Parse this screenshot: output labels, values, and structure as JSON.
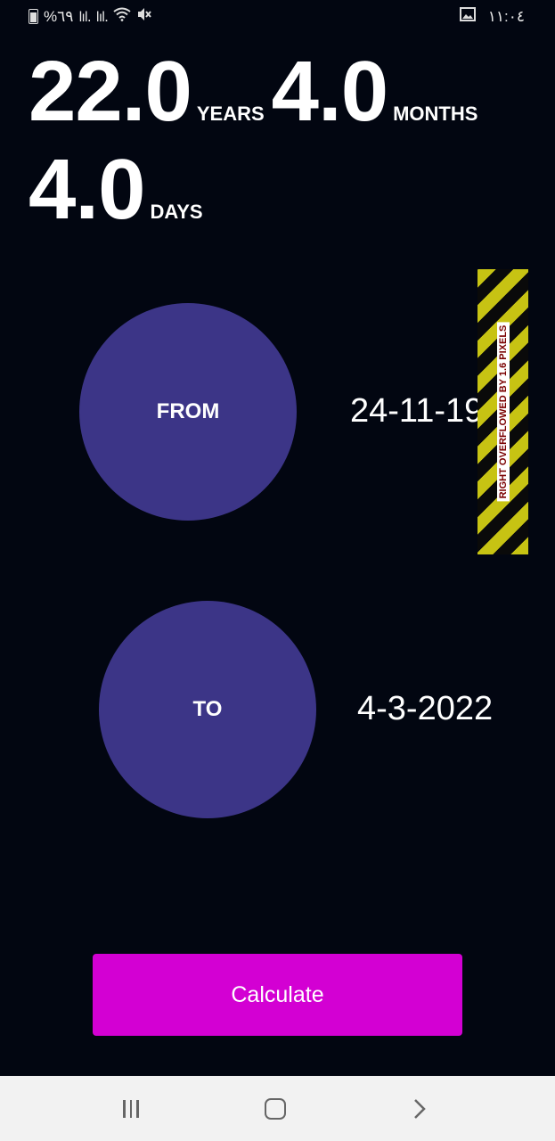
{
  "status_bar": {
    "battery_percent": "%٦٩",
    "signal_1": "lıl.",
    "signal_2": "lıl.",
    "time": "١١:٠٤",
    "icons": [
      "battery-icon",
      "signal-icon",
      "signal-icon",
      "wifi-icon",
      "mute-icon",
      "image-icon"
    ]
  },
  "result": {
    "years_value": "22.0",
    "years_label": "YEARS",
    "months_value": "4.0",
    "months_label": "MONTHS",
    "days_value": "4.0",
    "days_label": "DAYS"
  },
  "from": {
    "label": "FROM",
    "date": "24-11-1999"
  },
  "to": {
    "label": "TO",
    "date": "4-3-2022"
  },
  "overflow_warning": "RIGHT OVERFLOWED BY 1.6 PIXELS",
  "calculate_label": "Calculate",
  "colors": {
    "background": "#020611",
    "circle": "#3c3587",
    "button": "#d300d3",
    "nav_bar": "#f2f2f2"
  }
}
